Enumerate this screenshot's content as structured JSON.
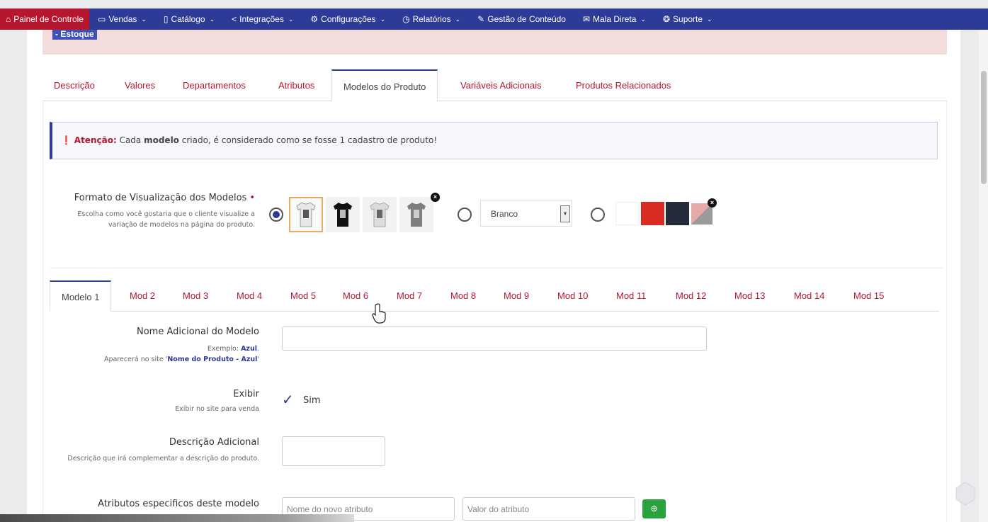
{
  "nav": {
    "items": [
      {
        "label": "Painel de Controle",
        "icon": "home-icon",
        "glyph": "⌂",
        "dropdown": false
      },
      {
        "label": "Vendas",
        "icon": "cart-icon",
        "glyph": "▭",
        "dropdown": true
      },
      {
        "label": "Catálogo",
        "icon": "book-icon",
        "glyph": "▯",
        "dropdown": true
      },
      {
        "label": "Integrações",
        "icon": "share-icon",
        "glyph": "<",
        "dropdown": true
      },
      {
        "label": "Configurações",
        "icon": "gear-icon",
        "glyph": "⚙",
        "dropdown": true
      },
      {
        "label": "Relatórios",
        "icon": "chart-icon",
        "glyph": "◷",
        "dropdown": true
      },
      {
        "label": "Gestão de Conteúdo",
        "icon": "edit-icon",
        "glyph": "✎",
        "dropdown": false
      },
      {
        "label": "Mala Direta",
        "icon": "mail-icon",
        "glyph": "✉",
        "dropdown": true
      },
      {
        "label": "Suporte",
        "icon": "support-icon",
        "glyph": "❂",
        "dropdown": true
      }
    ]
  },
  "header": {
    "estoque": "- Estoque"
  },
  "tabs": {
    "descricao": "Descrição",
    "valores": "Valores",
    "departamentos": "Departamentos",
    "atributos": "Atributos",
    "modelos": "Modelos do Produto",
    "variaveis": "Variáveis Adicionais",
    "relacionados": "Produtos Relacionados"
  },
  "warning": {
    "icon": "warning-icon",
    "label": "Atenção:",
    "text_before": " Cada ",
    "bold": "modelo",
    "text_after": " criado, é considerado como se fosse 1 cadastro de produto!"
  },
  "formato": {
    "label": "Formato de Visualização dos Modelos",
    "required": "•",
    "help": "Escolha como você gostaria que o cliente visualize a variação de modelos na página do produto.",
    "selected_option": "images",
    "select_value": "Branco",
    "swatch_colors": [
      "#ffffff",
      "#d72b23",
      "#232a3a"
    ]
  },
  "model_tabs": [
    "Modelo 1",
    "Mod 2",
    "Mod 3",
    "Mod 4",
    "Mod 5",
    "Mod 6",
    "Mod 7",
    "Mod 8",
    "Mod 9",
    "Mod 10",
    "Mod 11",
    "Mod 12",
    "Mod 13",
    "Mod 14",
    "Mod 15"
  ],
  "fields": {
    "nome": {
      "label": "Nome Adicional do Modelo",
      "help1_prefix": "Exemplo: ",
      "help1_bold": "Azul",
      "help1_suffix": ".",
      "help2_prefix": "Aparecerá no site '",
      "help2_bold": "Nome do Produto - Azul",
      "help2_suffix": "'",
      "value": ""
    },
    "exibir": {
      "label": "Exibir",
      "help": "Exibir no site para venda",
      "check_label": "Sim",
      "checked": true
    },
    "descricao": {
      "label": "Descrição Adicional",
      "help": "Descrição que irá complementar a descrição do produto.",
      "value": ""
    },
    "atributos": {
      "label": "Atributos especificos deste modelo",
      "name_placeholder": "Nome do novo atributo",
      "value_placeholder": "Valor do atributo"
    }
  },
  "colors": {
    "nav_bg": "#2e3b96",
    "accent_red": "#b5172f",
    "success": "#2aa33f"
  }
}
